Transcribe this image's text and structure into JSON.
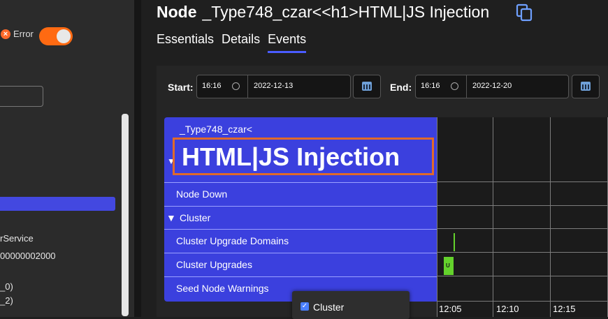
{
  "sidebar": {
    "error_label": "Error",
    "toggle_state": "on",
    "items": [
      "rService",
      "00000002000",
      "_0)",
      "_2)"
    ]
  },
  "header": {
    "title_prefix": "Node",
    "title_name": "_Type748_czar<<h1>HTML|JS Injection",
    "tabs": [
      {
        "label": "Essentials",
        "active": false
      },
      {
        "label": "Details",
        "active": false
      },
      {
        "label": "Events",
        "active": true
      }
    ]
  },
  "filters": {
    "start_label": "Start:",
    "start_time": "16:16",
    "start_date": "2022-12-13",
    "end_label": "End:",
    "end_time": "16:16",
    "end_date": "2022-12-20"
  },
  "tree": {
    "crumb": "_Type748_czar<",
    "injection_text": "HTML|JS Injection",
    "rows": [
      "Node Down",
      "Cluster",
      "Cluster Upgrade Domains",
      "Cluster Upgrades",
      "Seed Node Warnings"
    ]
  },
  "timeline": {
    "ticks": [
      "12:05",
      "12:10",
      "12:15"
    ],
    "event_label": "U",
    "colors": {
      "event": "#64d22c",
      "tree": "#3b40de",
      "accent": "#4a5cff",
      "toggle": "#ff6a12"
    }
  },
  "popup": {
    "label": "Cluster",
    "checked": true
  }
}
